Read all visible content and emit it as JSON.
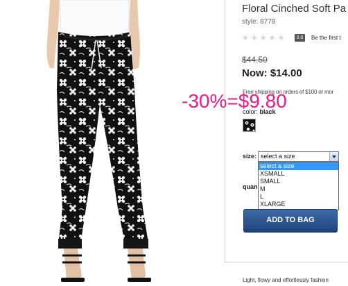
{
  "product": {
    "title": "Floral Cinched Soft Pa",
    "style": "style: 8778",
    "stars": "★★★★★",
    "rating_count": "0.0",
    "be_first": "Be the first t"
  },
  "pricing": {
    "old_price": "$44.50",
    "now_price": "Now: $14.00",
    "free_shipping": "Free shipping on orders of $100 or mor",
    "discount_overlay": "-30%=$9.80",
    "discount_color": "#ee1a8a"
  },
  "color": {
    "label": "color:",
    "value": "black"
  },
  "size": {
    "label": "size:",
    "selected": "select a size",
    "options": [
      "select a size",
      "XSMALL",
      "SMALL",
      "M",
      "L",
      "XLARGE"
    ]
  },
  "quantity": {
    "label": "quan"
  },
  "actions": {
    "add_to_bag": "ADD TO BAG"
  },
  "description": {
    "text": "Light, flowy and effortlessly fashion"
  },
  "icons": {
    "select_arrow": "chevron-down-icon",
    "swatch": "floral-swatch-icon"
  }
}
